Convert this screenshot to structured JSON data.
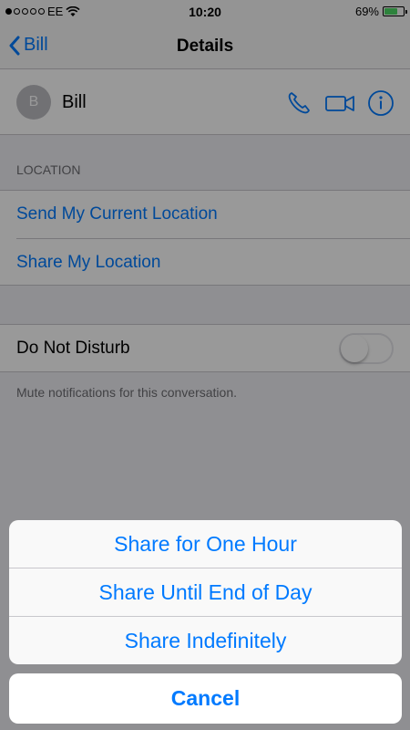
{
  "status_bar": {
    "carrier": "EE",
    "time": "10:20",
    "battery_percent": "69%",
    "battery_level": 0.69,
    "signal_bars_filled": 1,
    "signal_bars_total": 5
  },
  "nav": {
    "back_label": "Bill",
    "title": "Details"
  },
  "contact": {
    "avatar_initial": "B",
    "name": "Bill",
    "icons": [
      "phone-icon",
      "video-icon",
      "info-icon"
    ]
  },
  "location": {
    "header": "LOCATION",
    "send_current": "Send My Current Location",
    "share_my": "Share My Location"
  },
  "do_not_disturb": {
    "label": "Do Not Disturb",
    "enabled": false,
    "note": "Mute notifications for this conversation."
  },
  "action_sheet": {
    "options": [
      "Share for One Hour",
      "Share Until End of Day",
      "Share Indefinitely"
    ],
    "cancel": "Cancel"
  },
  "colors": {
    "accent": "#007aff",
    "battery": "#4cd964",
    "group_bg": "#efeff4"
  }
}
